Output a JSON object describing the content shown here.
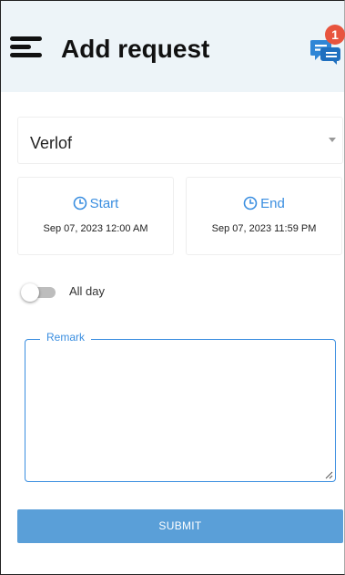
{
  "header": {
    "title": "Add request",
    "menu_icon": "hamburger-menu-icon",
    "chat_icon": "chat-bubbles-icon",
    "notification_count": "1"
  },
  "form": {
    "request_type": {
      "selected": "Verlof",
      "icon": "dropdown-caret-icon"
    },
    "start": {
      "label": "Start",
      "value": "Sep 07, 2023 12:00 AM",
      "icon": "clock-icon"
    },
    "end": {
      "label": "End",
      "value": "Sep 07, 2023 11:59 PM",
      "icon": "clock-icon"
    },
    "all_day": {
      "label": "All day",
      "enabled": false
    },
    "remark": {
      "label": "Remark",
      "value": ""
    },
    "submit_label": "SUBMIT"
  },
  "colors": {
    "header_bg": "#edf4f8",
    "accent": "#3a8ee0",
    "badge": "#e8543e",
    "submit_bg": "#5a9fd8"
  }
}
